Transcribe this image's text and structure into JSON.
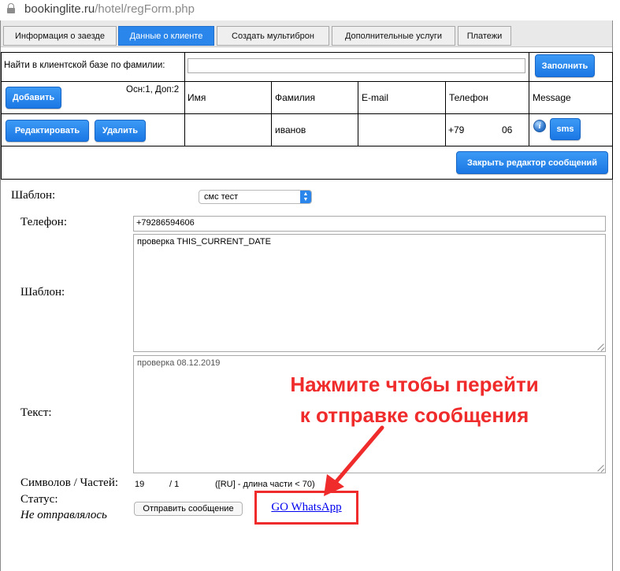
{
  "browser": {
    "url_host": "bookinglite.ru",
    "url_path": "/hotel/regForm.php"
  },
  "tabs": [
    {
      "label": "Информация о заезде",
      "active": false
    },
    {
      "label": "Данные о клиенте",
      "active": true
    },
    {
      "label": "Создать мультиброн",
      "active": false
    },
    {
      "label": "Дополнительные услуги",
      "active": false
    },
    {
      "label": "Платежи",
      "active": false
    }
  ],
  "search": {
    "label": "Найти в клиентской базе по фамилии:",
    "value": "",
    "fill_button": "Заполнить"
  },
  "clients": {
    "add_button": "Добавить",
    "counts": "Осн:1, Доп:2",
    "headers": [
      "Имя",
      "Фамилия",
      "E-mail",
      "Телефон",
      "Message"
    ],
    "edit_button": "Редактировать",
    "delete_button": "Удалить",
    "row": {
      "first_name": "",
      "last_name": "иванов",
      "email": "",
      "phone_start": "+79",
      "phone_end": "06"
    },
    "sms_button": "sms"
  },
  "editor": {
    "close_button": "Закрыть редактор сообщений",
    "template_label": "Шаблон:",
    "template_selected": "смс тест",
    "phone_label": "Телефон:",
    "phone_value": "+79286594606",
    "template_text_label": "Шаблон:",
    "template_text": "проверка THIS_CURRENT_DATE",
    "text_label": "Текст:",
    "text_value": "проверка 08.12.2019",
    "symbols_label": "Символов / Частей:",
    "symbols": "19",
    "parts": "/ 1",
    "parts_note": "([RU] - длина части < 70)",
    "status_label": "Статус:",
    "status_value": "Не отправлялось",
    "send_button": "Отправить сообщение",
    "whatsapp_link": "GO WhatsApp"
  },
  "annotation": {
    "line1": "Нажмите чтобы перейти",
    "line2": "к отправке сообщения",
    "color": "#ef2b2b"
  }
}
